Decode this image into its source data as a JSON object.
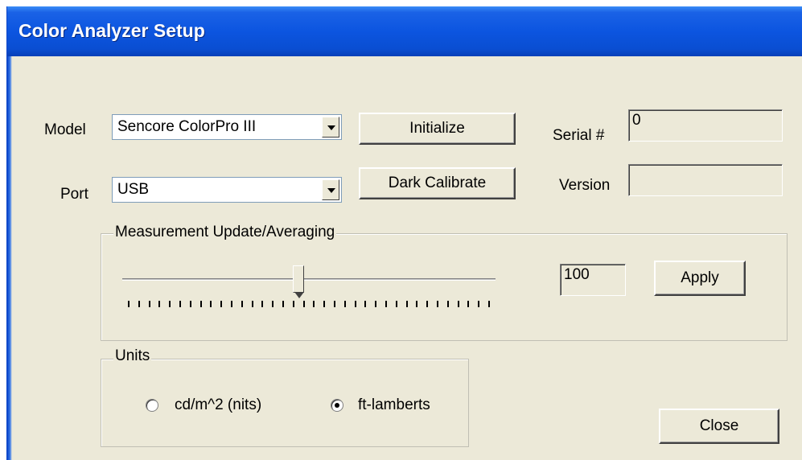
{
  "window": {
    "title": "Color Analyzer Setup"
  },
  "model": {
    "label": "Model",
    "value": "Sencore ColorPro III"
  },
  "port": {
    "label": "Port",
    "value": "USB"
  },
  "buttons": {
    "initialize": "Initialize",
    "dark_calibrate": "Dark Calibrate",
    "apply": "Apply",
    "close": "Close"
  },
  "serial": {
    "label": "Serial #",
    "value": "0"
  },
  "version": {
    "label": "Version",
    "value": ""
  },
  "measurement": {
    "group_label": "Measurement Update/Averaging",
    "value": "100",
    "slider_fraction": 0.47,
    "tick_count": 36
  },
  "units": {
    "group_label": "Units",
    "options": [
      "cd/m^2 (nits)",
      "ft-lamberts"
    ],
    "selected": "ft-lamberts"
  },
  "icons": {
    "dropdown": "chevron-down-icon"
  }
}
